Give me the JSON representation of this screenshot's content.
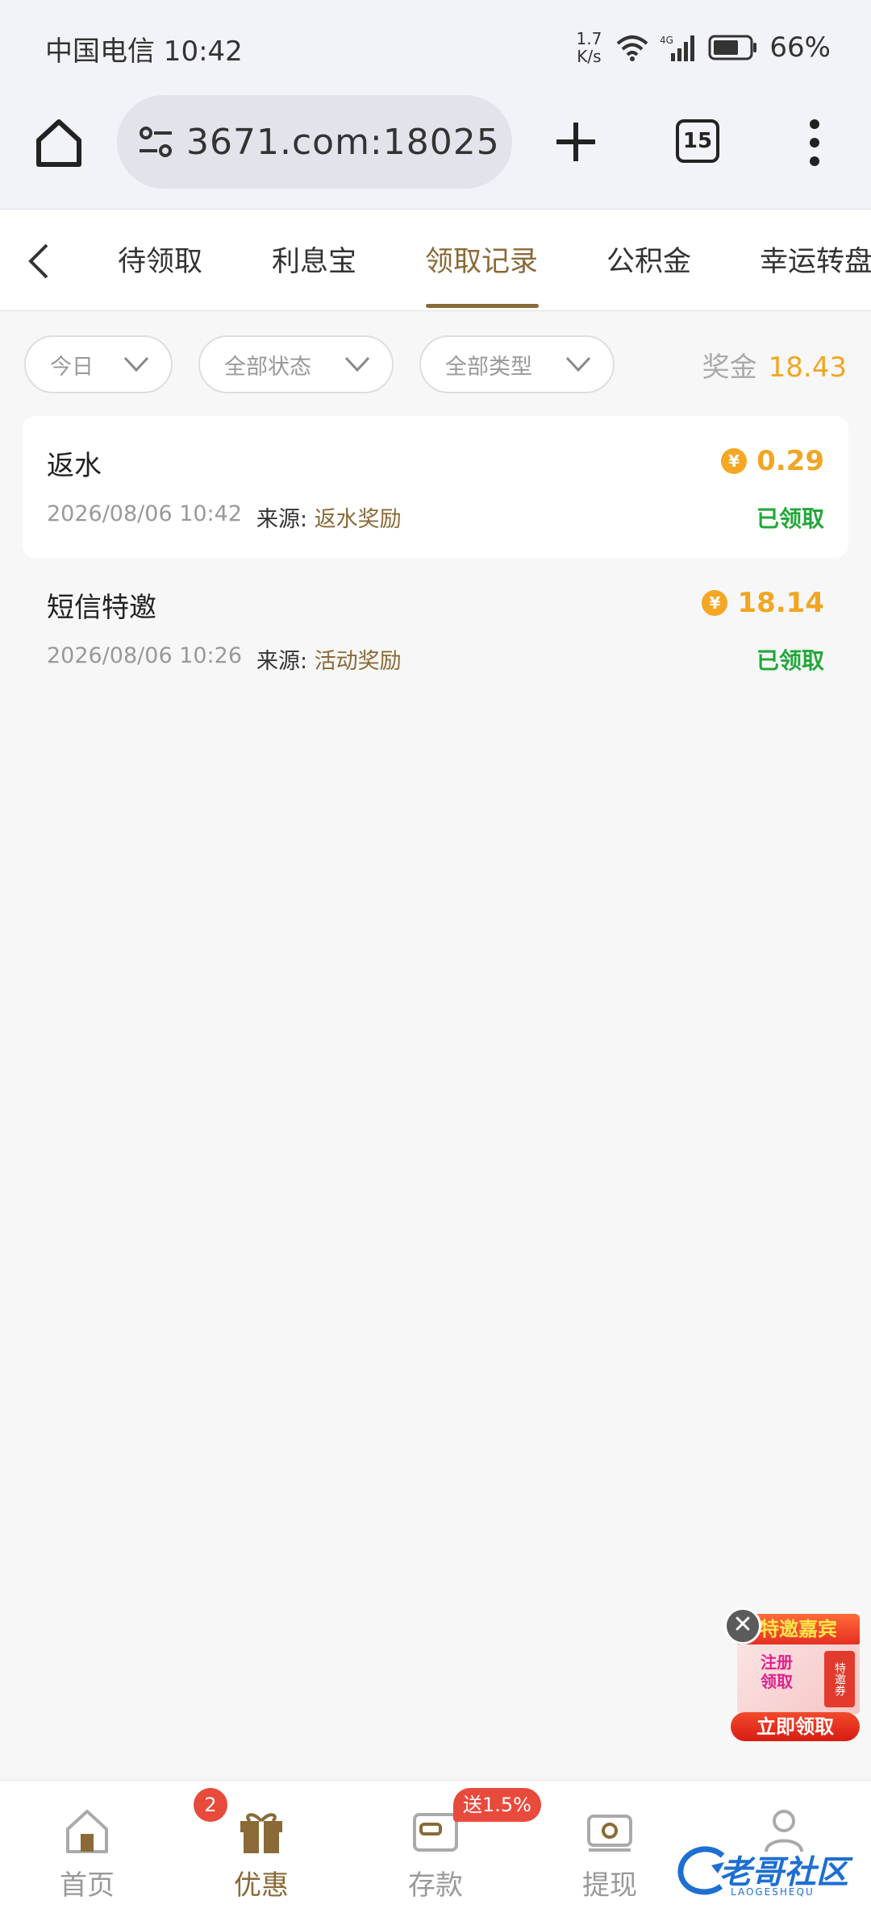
{
  "status_bar": {
    "carrier_time": "中国电信 10:42",
    "net_speed_value": "1.7",
    "net_speed_unit": "K/s",
    "network_type": "4G",
    "battery": "66%"
  },
  "browser": {
    "url": "3671.com:18025",
    "tab_count": "15"
  },
  "tabs": [
    {
      "label": "待领取",
      "active": false
    },
    {
      "label": "利息宝",
      "active": false
    },
    {
      "label": "领取记录",
      "active": true
    },
    {
      "label": "公积金",
      "active": false
    },
    {
      "label": "幸运转盘",
      "active": false
    }
  ],
  "filters": {
    "date": "今日",
    "status": "全部状态",
    "type": "全部类型",
    "bonus_label": "奖金",
    "bonus_value": "18.43"
  },
  "records": [
    {
      "title": "返水",
      "amount": "0.29",
      "time": "2026/08/06 10:42",
      "source_label": "来源: ",
      "source_value": "返水奖励",
      "status": "已领取"
    },
    {
      "title": "短信特邀",
      "amount": "18.14",
      "time": "2026/08/06 10:26",
      "source_label": "来源: ",
      "source_value": "活动奖励",
      "status": "已领取"
    }
  ],
  "coin_symbol": "¥",
  "promo": {
    "banner": "特邀嘉宾",
    "card_text": "注册领取",
    "ticket": "特邀券",
    "button": "立即领取",
    "close": "✕"
  },
  "bottom_nav": {
    "items": [
      {
        "label": "首页",
        "icon": "home-icon"
      },
      {
        "label": "优惠",
        "icon": "gift-icon",
        "active": true
      },
      {
        "label": "存款",
        "icon": "wallet-icon"
      },
      {
        "label": "提现",
        "icon": "cash-icon"
      },
      {
        "label": "我的",
        "icon": "user-icon"
      }
    ],
    "promo_badge_count": "2",
    "deposit_badge": "送1.5%"
  },
  "watermark": {
    "text": "老哥社区",
    "sub": "LAOGESHEQU"
  },
  "colors": {
    "accent": "#8a6a37",
    "gold": "#f0a623",
    "success": "#21a839",
    "badge": "#e84a3c"
  }
}
